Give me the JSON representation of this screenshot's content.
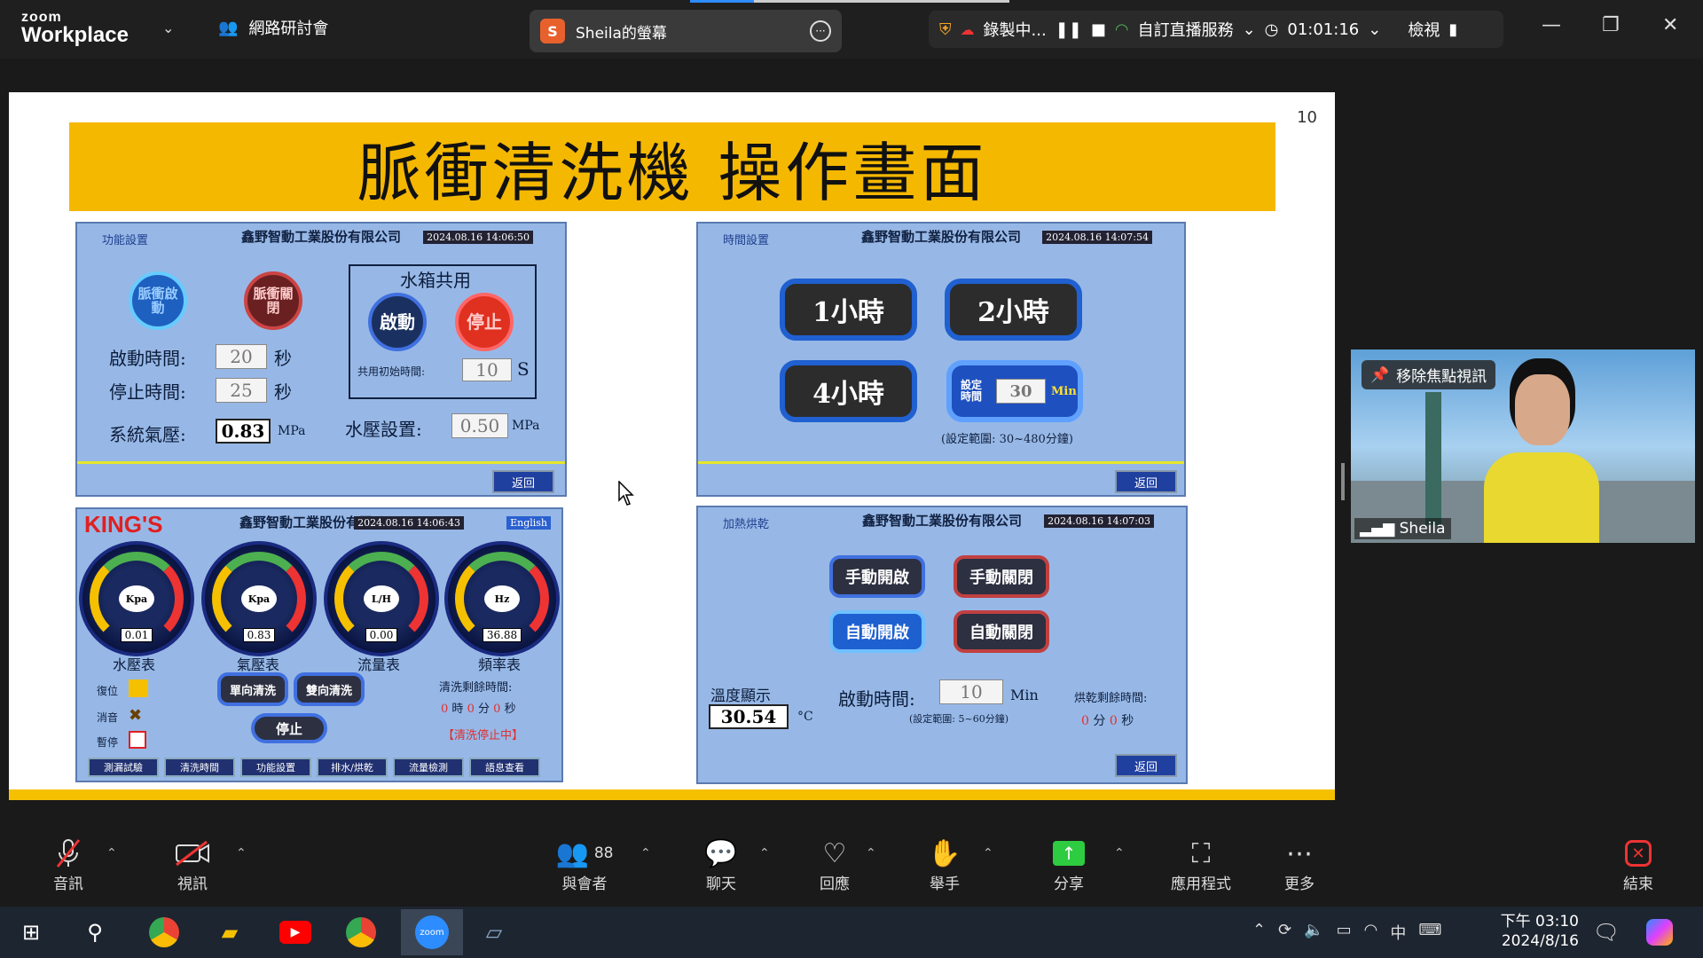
{
  "app": {
    "logo_top": "zoom",
    "logo_bottom": "Workplace",
    "meeting_type": "網路研討會"
  },
  "share": {
    "avatar": "S",
    "title": "Sheila的螢幕"
  },
  "status": {
    "recording": "錄製中...",
    "live": "自訂直播服務",
    "timer": "01:01:16",
    "view": "檢視"
  },
  "slide": {
    "number": "10",
    "title": "脈衝清洗機 操作畫面",
    "panel1": {
      "tag": "功能設置",
      "corp": "鑫野智動工業股份有限公司",
      "ts": "2024.08.16 14:06:50",
      "btn_start": "脈衝啟動",
      "btn_close": "脈衝關閉",
      "tank": "水箱共用",
      "tank_start": "啟動",
      "tank_stop": "停止",
      "start_time_label": "啟動時間:",
      "start_time": "20",
      "stop_time_label": "停止時間:",
      "stop_time": "25",
      "sec": "秒",
      "share_label": "共用初始時間:",
      "share_val": "10",
      "share_unit": "S",
      "pressure_label": "系統氣壓:",
      "pressure": "0.83",
      "mpa": "MPa",
      "water_label": "水壓設置:",
      "water": "0.50",
      "ret": "返回"
    },
    "panel2": {
      "tag": "時間設置",
      "corp": "鑫野智動工業股份有限公司",
      "ts": "2024.08.16 14:07:54",
      "h1": "1小時",
      "h2": "2小時",
      "h4": "4小時",
      "set_label": "設定時間",
      "set_val": "30",
      "set_unit": "Min",
      "range": "(設定範圍: 30~480分鐘)",
      "ret": "返回"
    },
    "panel3": {
      "brand": "KING'S",
      "corp": "鑫野智動工業股份有限公司",
      "ts": "2024.08.16 14:06:43",
      "lang": "English",
      "gauges": [
        {
          "unit": "Kpa",
          "value": "0.01",
          "label": "水壓表"
        },
        {
          "unit": "Kpa",
          "value": "0.83",
          "label": "氣壓表"
        },
        {
          "unit": "L/H",
          "value": "0.00",
          "label": "流量表"
        },
        {
          "unit": "Hz",
          "value": "36.88",
          "label": "頻率表"
        }
      ],
      "reset": "復位",
      "mute": "消音",
      "pause": "暫停",
      "single": "單向清洗",
      "double": "雙向清洗",
      "stop": "停止",
      "remain": "清洗剩餘時間:",
      "remain_h": "0",
      "remain_m": "0",
      "remain_s": "0",
      "h": "時",
      "m": "分",
      "s": "秒",
      "status": "【清洗停止中】",
      "nav": [
        "測漏試驗",
        "清洗時間",
        "功能設置",
        "排水/烘乾",
        "流量檢測",
        "語息查看"
      ]
    },
    "panel4": {
      "tag": "加熱烘乾",
      "corp": "鑫野智動工業股份有限公司",
      "ts": "2024.08.16 14:07:03",
      "manual_open": "手動開啟",
      "manual_close": "手動關閉",
      "auto_open": "自動開啟",
      "auto_close": "自動關閉",
      "temp_label": "溫度顯示",
      "temp": "30.54",
      "temp_unit": "°C",
      "start_label": "啟動時間:",
      "start_val": "10",
      "start_unit": "Min",
      "range": "(設定範圍: 5~60分鐘)",
      "remain": "烘乾剩餘時間:",
      "remain_m": "0",
      "remain_s": "0",
      "m": "分",
      "s": "秒",
      "ret": "返回"
    }
  },
  "video": {
    "focus_btn": "移除焦點視訊",
    "name": "Sheila"
  },
  "controls": {
    "audio": "音訊",
    "video": "視訊",
    "participants": "與會者",
    "participants_count": "88",
    "chat": "聊天",
    "react": "回應",
    "raise": "舉手",
    "share": "分享",
    "apps": "應用程式",
    "more": "更多",
    "end": "結束"
  },
  "taskbar": {
    "time": "下午 03:10",
    "date": "2024/8/16",
    "ime": "中"
  }
}
